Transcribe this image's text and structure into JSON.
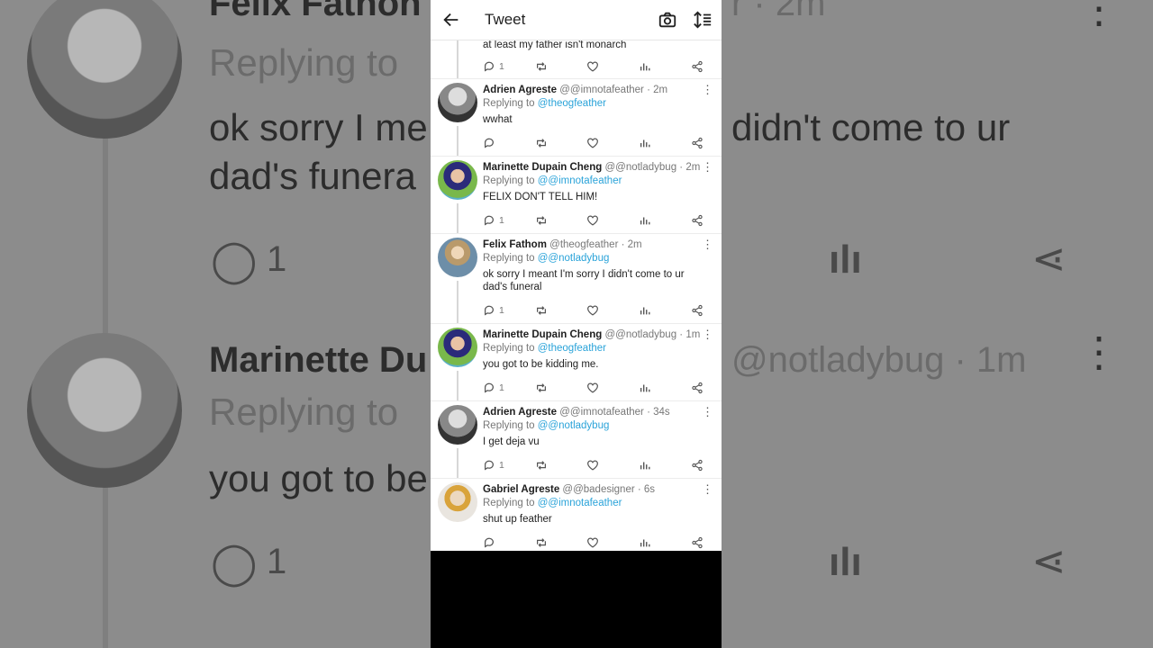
{
  "app": {
    "title": "Tweet",
    "back_icon": "back-arrow-icon",
    "camera_icon": "camera-icon",
    "sort_icon": "sort-icon"
  },
  "background": {
    "name1": "Felix Fathon",
    "handle1_tail": "r · 2m",
    "reply1": "Replying to",
    "text1a": "ok sorry I me",
    "text1b": "didn't come to ur",
    "text1c": "dad's funera",
    "count1": "1",
    "name2": "Marinette Du",
    "handle2_tail": "@notladybug · 1m",
    "reply2": "Replying to",
    "text2": "you got to be",
    "count2": "1"
  },
  "partial_tweet": {
    "text": "at least my father isn't monarch",
    "reply_count": "1"
  },
  "tweets": [
    {
      "name": "Adrien Agreste",
      "handle": "@@imnotafeather",
      "time": "· 2m",
      "replying_label": "Replying to",
      "mention": "@theogfeather",
      "text": "wwhat",
      "reply_count": ""
    },
    {
      "name": "Marinette Dupain Cheng",
      "handle": "@@notladybug",
      "time": "· 2m",
      "replying_label": "Replying to",
      "mention": "@@imnotafeather",
      "text": "FELIX DON'T TELL HIM!",
      "reply_count": "1"
    },
    {
      "name": "Felix Fathom",
      "handle": "@theogfeather",
      "time": "· 2m",
      "replying_label": "Replying to",
      "mention": "@@notladybug",
      "text": "ok sorry I meant I'm sorry I didn't come to ur dad's funeral",
      "reply_count": "1"
    },
    {
      "name": "Marinette Dupain Cheng",
      "handle": "@@notladybug",
      "time": "· 1m",
      "replying_label": "Replying to",
      "mention": "@theogfeather",
      "text": "you got to be kidding me.",
      "reply_count": "1"
    },
    {
      "name": "Adrien Agreste",
      "handle": "@@imnotafeather",
      "time": "· 34s",
      "replying_label": "Replying to",
      "mention": "@@notladybug",
      "text": "I get deja vu",
      "reply_count": "1"
    },
    {
      "name": "Gabriel Agreste",
      "handle": "@@badesigner",
      "time": "· 6s",
      "replying_label": "Replying to",
      "mention": "@@imnotafeather",
      "text": "shut up feather",
      "reply_count": ""
    }
  ],
  "colors": {
    "mention": "#2aa3d9",
    "icon": "#555555"
  }
}
